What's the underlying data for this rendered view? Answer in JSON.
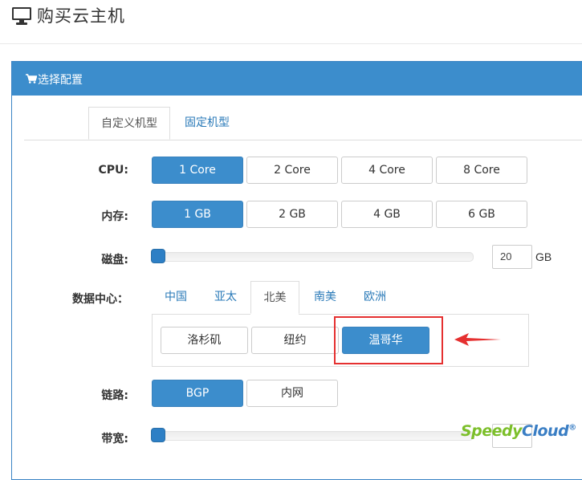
{
  "header": {
    "title": "购买云主机",
    "icon": "monitor-icon"
  },
  "panel": {
    "title": "选择配置",
    "icon": "cart-icon",
    "tabs": [
      {
        "label": "自定义机型",
        "active": true
      },
      {
        "label": "固定机型",
        "active": false
      }
    ]
  },
  "cpu": {
    "label": "CPU:",
    "options": [
      "1 Core",
      "2 Core",
      "4 Core",
      "8 Core"
    ],
    "selected": "1 Core"
  },
  "memory": {
    "label": "内存:",
    "options": [
      "1 GB",
      "2 GB",
      "4 GB",
      "6 GB"
    ],
    "selected": "1 GB"
  },
  "disk": {
    "label": "磁盘:",
    "value": "20",
    "unit": "GB"
  },
  "datacenter": {
    "label": "数据中心：",
    "regions": [
      "中国",
      "亚太",
      "北美",
      "南美",
      "欧洲"
    ],
    "active_region": "北美",
    "cities": [
      "洛杉矶",
      "纽约",
      "温哥华"
    ],
    "selected_city": "温哥华"
  },
  "network": {
    "label": "链路:",
    "options": [
      "BGP",
      "内网"
    ],
    "selected": "BGP"
  },
  "bandwidth": {
    "label": "带宽:"
  },
  "watermark": {
    "part1": "Speedy",
    "part2": "Cloud",
    "mark": "®"
  },
  "colors": {
    "primary": "#3c8dcc",
    "highlight": "#e53030"
  }
}
